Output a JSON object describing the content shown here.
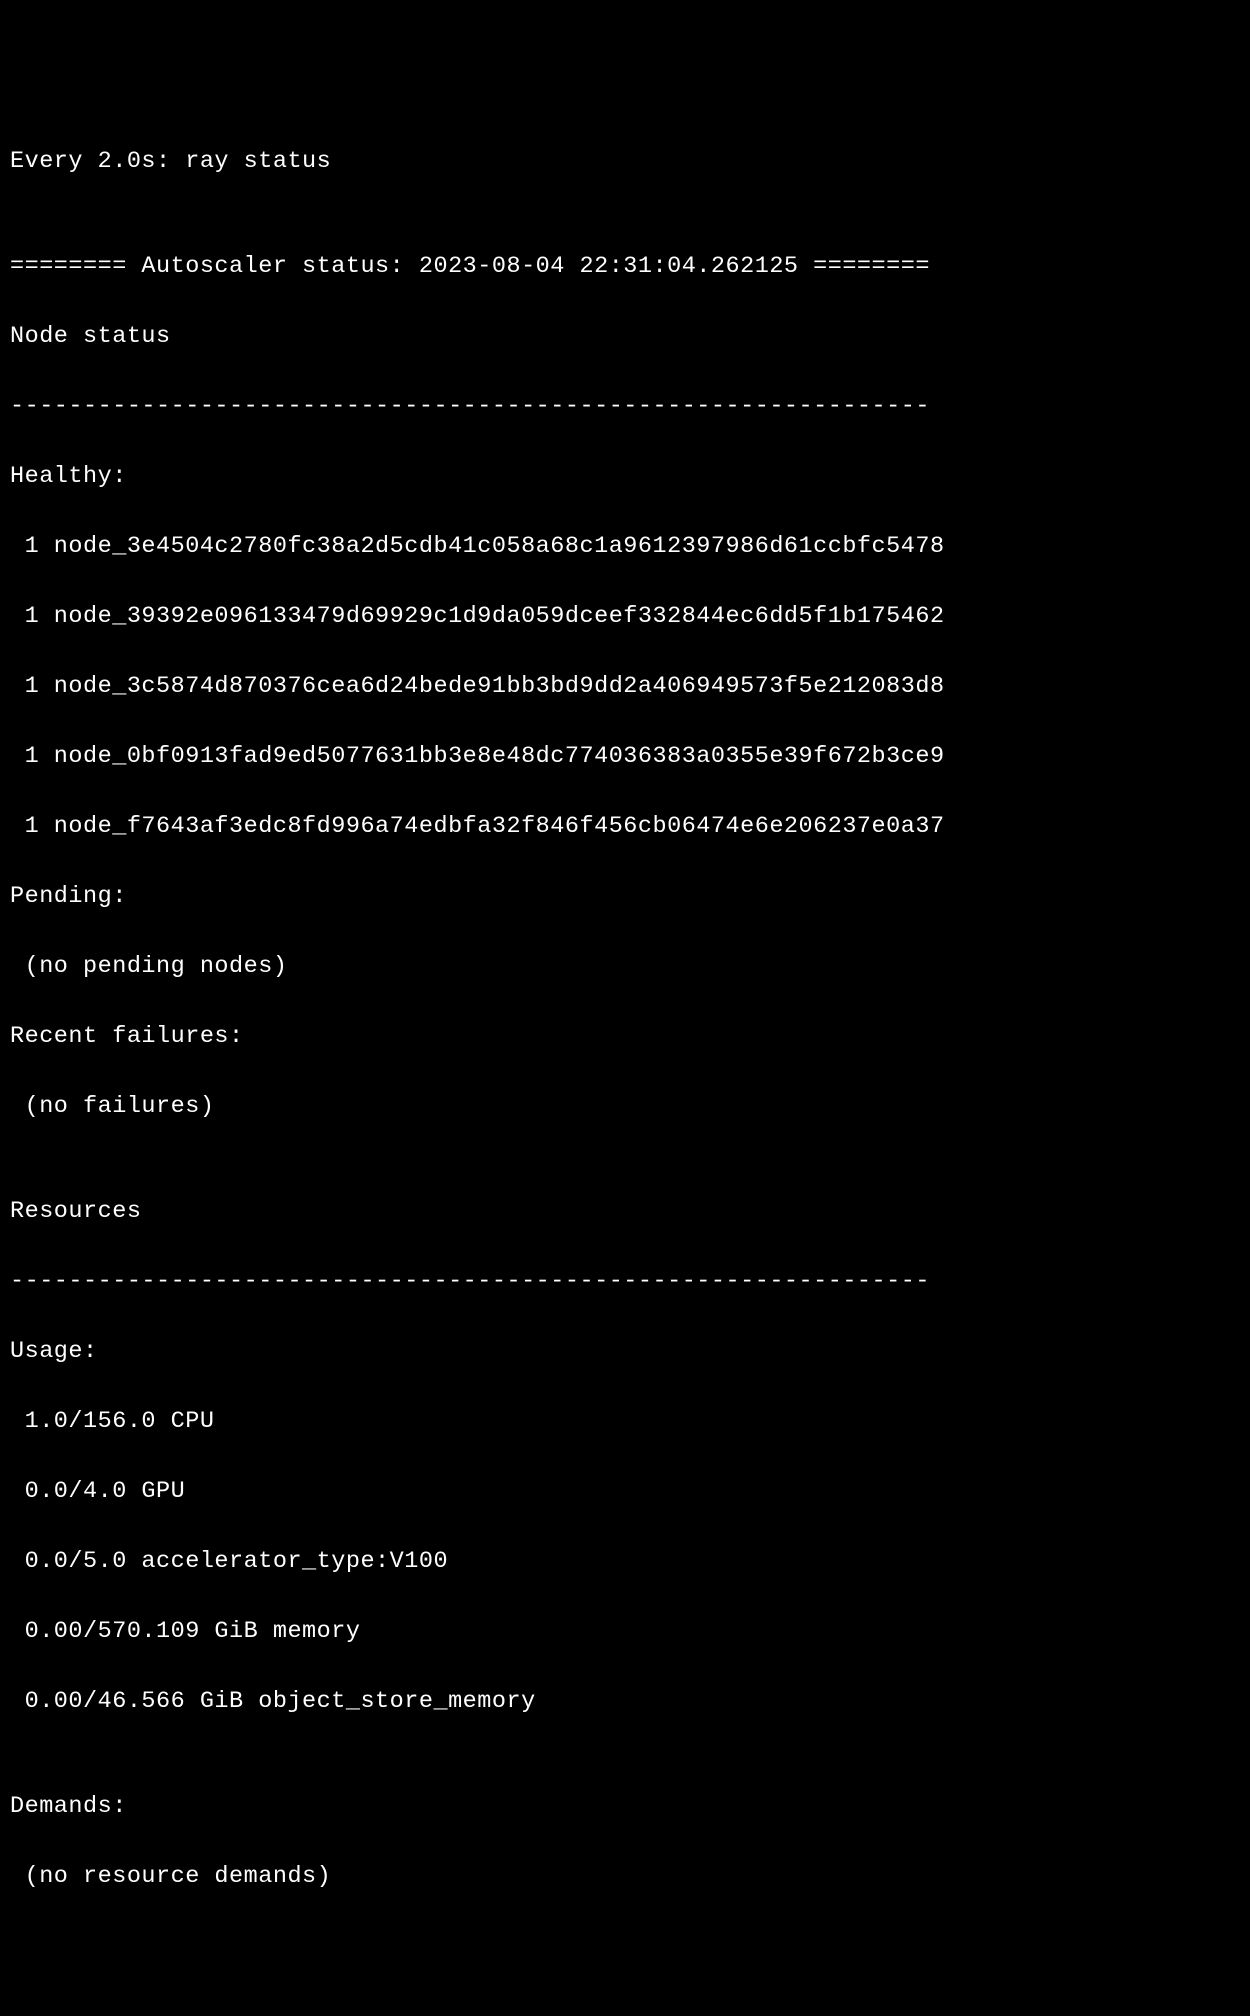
{
  "watch_header": "Every 2.0s: ray status",
  "blank1": "",
  "autoscaler_header": "======== Autoscaler status: 2023-08-04 22:31:04.262125 ========",
  "node_status_header": "Node status",
  "divider1": "---------------------------------------------------------------",
  "healthy_label": "Healthy:",
  "healthy_nodes": [
    " 1 node_3e4504c2780fc38a2d5cdb41c058a68c1a9612397986d61ccbfc5478",
    " 1 node_39392e096133479d69929c1d9da059dceef332844ec6dd5f1b175462",
    " 1 node_3c5874d870376cea6d24bede91bb3bd9dd2a406949573f5e212083d8",
    " 1 node_0bf0913fad9ed5077631bb3e8e48dc774036383a0355e39f672b3ce9",
    " 1 node_f7643af3edc8fd996a74edbfa32f846f456cb06474e6e206237e0a37"
  ],
  "pending_label": "Pending:",
  "pending_status": " (no pending nodes)",
  "recent_failures_label": "Recent failures:",
  "recent_failures_status": " (no failures)",
  "blank2": "",
  "resources_header": "Resources",
  "divider2": "---------------------------------------------------------------",
  "usage_label": "Usage:",
  "usage_lines": [
    " 1.0/156.0 CPU",
    " 0.0/4.0 GPU",
    " 0.0/5.0 accelerator_type:V100",
    " 0.00/570.109 GiB memory",
    " 0.00/46.566 GiB object_store_memory"
  ],
  "blank3": "",
  "demands_label": "Demands:",
  "demands_status": " (no resource demands)"
}
